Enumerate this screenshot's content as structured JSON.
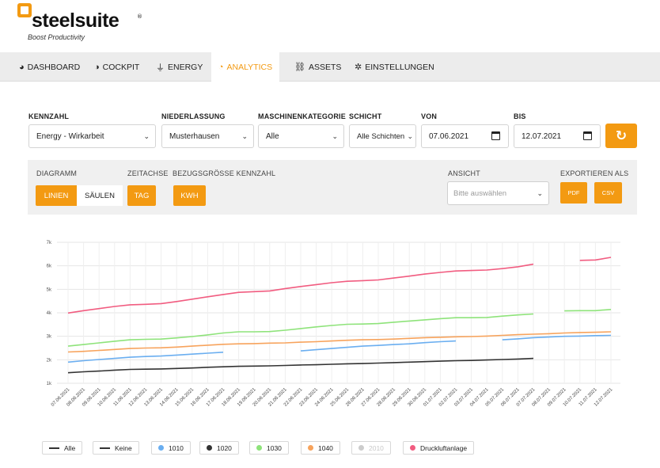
{
  "brand": {
    "name": "steelsuite",
    "reg": "®",
    "tagline": "Boost Productivity"
  },
  "nav": [
    {
      "icon": "gauge-icon",
      "glyph": "◕",
      "label": "DASHBOARD",
      "active": false
    },
    {
      "icon": "cockpit-icon",
      "glyph": "◑",
      "label": "COCKPIT",
      "active": false
    },
    {
      "icon": "plug-icon",
      "glyph": "⏚",
      "label": "ENERGY",
      "active": false
    },
    {
      "icon": "analytics-icon",
      "glyph": "◔",
      "label": "ANALYTICS",
      "active": true
    },
    {
      "icon": "sitemap-icon",
      "glyph": "⛓",
      "label": "ASSETS",
      "active": false
    },
    {
      "icon": "gear-icon",
      "glyph": "✲",
      "label": "EINSTELLUNGEN",
      "active": false
    }
  ],
  "filters": {
    "kennzahl": {
      "label": "KENNZAHL",
      "value": "Energy - Wirkarbeit"
    },
    "niederlassung": {
      "label": "NIEDERLASSUNG",
      "value": "Musterhausen"
    },
    "maschinenkategorie": {
      "label": "MASCHINENKATEGORIE",
      "value": "Alle"
    },
    "schicht": {
      "label": "SCHICHT",
      "value": "Alle Schichten"
    },
    "von": {
      "label": "VON",
      "value": "07.06.2021"
    },
    "bis": {
      "label": "BIS",
      "value": "12.07.2021"
    }
  },
  "diagram_panel": {
    "diagramm_label": "DIAGRAMM",
    "linien": "LINIEN",
    "saeulen": "SÄULEN",
    "zeitachse_label": "ZEITACHSE",
    "tag": "TAG",
    "bezug_label": "BEZUGSGRÖSSE KENNZAHL",
    "kwh": "KWH",
    "ansicht_label": "ANSICHT",
    "ansicht_placeholder": "Bitte auswählen",
    "export_label": "EXPORTIEREN ALS",
    "pdf": "PDF",
    "csv": "CSV"
  },
  "legend": [
    {
      "label": "Alle",
      "marker": "dash",
      "color": "#333333",
      "disabled": false
    },
    {
      "label": "Keine",
      "marker": "dash",
      "color": "#333333",
      "disabled": false
    },
    {
      "label": "1010",
      "marker": "dot",
      "color": "#6aaef0",
      "disabled": false
    },
    {
      "label": "1020",
      "marker": "dot",
      "color": "#333333",
      "disabled": false
    },
    {
      "label": "1030",
      "marker": "dot",
      "color": "#8ee37a",
      "disabled": false
    },
    {
      "label": "1040",
      "marker": "dot",
      "color": "#f7a35c",
      "disabled": false
    },
    {
      "label": "2010",
      "marker": "dot",
      "color": "#cccccc",
      "disabled": true
    },
    {
      "label": "Druckluftanlage",
      "marker": "dot",
      "color": "#f15c80",
      "disabled": false
    }
  ],
  "chart_data": {
    "type": "line",
    "title": "",
    "xlabel": "",
    "ylabel": "",
    "ylim": [
      1000,
      7000
    ],
    "yticks": [
      "1k",
      "2k",
      "3k",
      "4k",
      "5k",
      "6k",
      "7k"
    ],
    "grid": true,
    "legend_position": "bottom",
    "x": [
      "07.06.2021",
      "08.06.2021",
      "09.06.2021",
      "10.06.2021",
      "11.06.2021",
      "12.06.2021",
      "13.06.2021",
      "14.06.2021",
      "15.06.2021",
      "16.06.2021",
      "17.06.2021",
      "18.06.2021",
      "19.06.2021",
      "20.06.2021",
      "21.06.2021",
      "22.06.2021",
      "23.06.2021",
      "24.06.2021",
      "25.06.2021",
      "26.06.2021",
      "27.06.2021",
      "28.06.2021",
      "29.06.2021",
      "30.06.2021",
      "01.07.2021",
      "02.07.2021",
      "03.07.2021",
      "04.07.2021",
      "05.07.2021",
      "06.07.2021",
      "07.07.2021",
      "08.07.2021",
      "09.07.2021",
      "10.07.2021",
      "11.07.2021",
      "12.07.2021"
    ],
    "series": [
      {
        "name": "1010",
        "color": "#6aaef0",
        "values": [
          1900,
          1960,
          2010,
          2060,
          2110,
          2140,
          2160,
          2200,
          2240,
          2280,
          2320,
          null,
          null,
          null,
          null,
          2380,
          2430,
          2480,
          2530,
          2580,
          2610,
          2650,
          2680,
          2730,
          2770,
          2800,
          null,
          null,
          2850,
          2890,
          2940,
          2970,
          3000,
          3010,
          3030,
          3040
        ]
      },
      {
        "name": "1020",
        "color": "#333333",
        "values": [
          1450,
          1490,
          1520,
          1560,
          1590,
          1600,
          1610,
          1630,
          1650,
          1680,
          1700,
          1720,
          1730,
          1740,
          1760,
          1780,
          1790,
          1810,
          1830,
          1840,
          1860,
          1880,
          1900,
          1920,
          1940,
          1960,
          1970,
          1990,
          2010,
          2030,
          2060,
          null,
          null,
          null,
          null,
          null
        ]
      },
      {
        "name": "1030",
        "color": "#8ee37a",
        "values": [
          2580,
          2650,
          2720,
          2790,
          2850,
          2870,
          2880,
          2930,
          2990,
          3060,
          3140,
          3190,
          3190,
          3200,
          3260,
          3330,
          3400,
          3460,
          3510,
          3520,
          3540,
          3600,
          3650,
          3700,
          3750,
          3790,
          3790,
          3800,
          3860,
          3910,
          3950,
          null,
          4080,
          4090,
          4090,
          4140
        ]
      },
      {
        "name": "1040",
        "color": "#f7a35c",
        "values": [
          2330,
          2360,
          2400,
          2440,
          2480,
          2500,
          2510,
          2540,
          2580,
          2620,
          2660,
          2680,
          2690,
          2710,
          2720,
          2750,
          2770,
          2800,
          2830,
          2850,
          2860,
          2880,
          2910,
          2940,
          2960,
          2980,
          2990,
          3010,
          3040,
          3070,
          3090,
          3110,
          3140,
          3160,
          3170,
          3190
        ]
      },
      {
        "name": "Druckluftanlage",
        "color": "#f15c80",
        "values": [
          3990,
          4090,
          4180,
          4270,
          4340,
          4360,
          4390,
          4480,
          4580,
          4680,
          4780,
          4870,
          4900,
          4930,
          5030,
          5120,
          5200,
          5280,
          5340,
          5370,
          5400,
          5480,
          5560,
          5650,
          5720,
          5780,
          5800,
          5820,
          5880,
          5960,
          6070,
          null,
          null,
          6230,
          6250,
          6360
        ]
      }
    ]
  }
}
